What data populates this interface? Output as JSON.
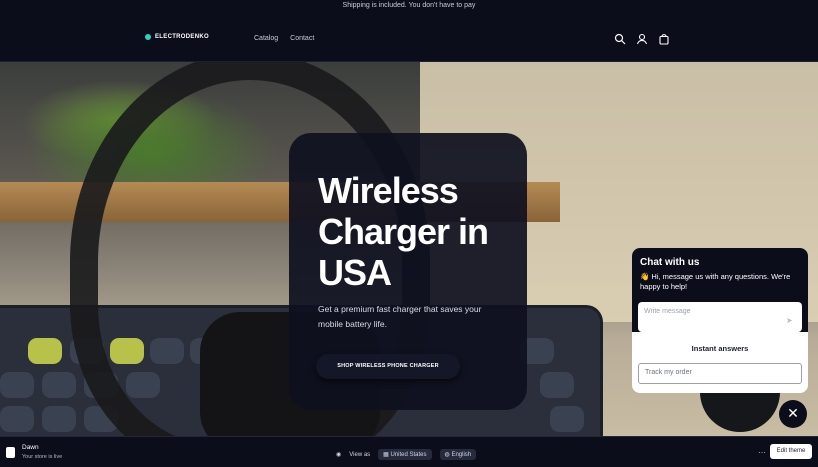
{
  "announcement": "Shipping is included. You don't have to pay",
  "header": {
    "logo_text": "ELECTRODENKO",
    "nav": [
      "Catalog",
      "Contact"
    ],
    "icons": [
      "search-icon",
      "account-icon",
      "cart-icon"
    ]
  },
  "hero": {
    "title": "Wireless Charger in USA",
    "subtitle": "Get a premium fast charger that saves your mobile battery life.",
    "button": "SHOP WIRELESS PHONE CHARGER"
  },
  "chat": {
    "title": "Chat with us",
    "message": "👋 Hi, message us with any questions. We're happy to help!",
    "input_placeholder": "Write message",
    "instant_answers": "Instant answers",
    "track_placeholder": "Track my order"
  },
  "footer": {
    "store_name": "Dawn",
    "theme_status": "Your store is live",
    "view_as": "View as",
    "country": "United States",
    "language": "English",
    "edit_button": "Edit theme"
  },
  "colors": {
    "accent": "#2fd1c4",
    "dark": "#0b0d1a"
  }
}
